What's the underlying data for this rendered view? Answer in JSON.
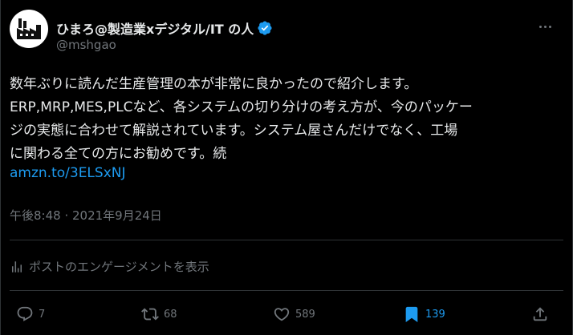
{
  "author": {
    "display_name": "ひまろ@製造業xデジタル/IT の人",
    "handle": "@mshgao",
    "verified": true
  },
  "menu": {
    "icon": "more-horizontal-icon"
  },
  "body": {
    "lines": [
      "数年ぶりに読んだ生産管理の本が非常に良かったので紹介します。",
      "ERP,MRP,MES,PLCなど、各システムの切り分けの考え方が、今のパッケー",
      "ジの実態に合わせて解説されています。システム屋さんだけでなく、工場",
      "に関わる全ての方にお勧めです。続"
    ],
    "link": "amzn.to/3ELSxNJ"
  },
  "timestamp": "午後8:48 · 2021年9月24日",
  "engagements": {
    "label": "ポストのエンゲージメントを表示"
  },
  "actions": {
    "replies": "7",
    "reposts": "68",
    "likes": "589",
    "bookmarks": "139"
  },
  "colors": {
    "background": "#000000",
    "text": "#e7e9ea",
    "muted": "#71767b",
    "accent": "#1d9bf0",
    "border": "#2f3336"
  }
}
